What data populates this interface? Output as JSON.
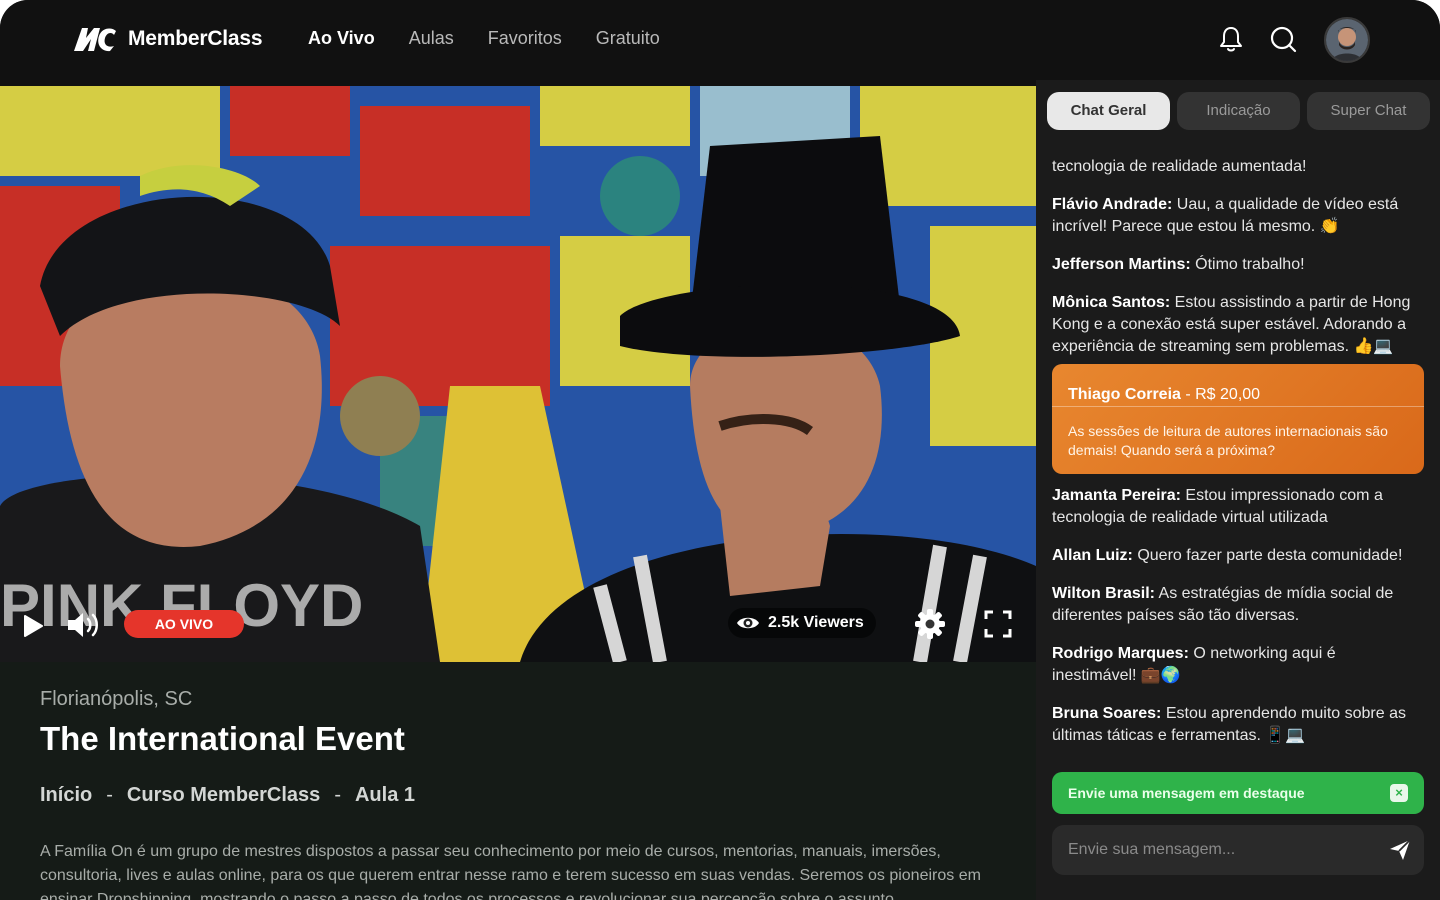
{
  "app": {
    "name": "MemberClass"
  },
  "nav": {
    "items": [
      "Ao Vivo",
      "Aulas",
      "Favoritos",
      "Gratuito"
    ],
    "active": "Ao Vivo"
  },
  "header": {
    "icons": [
      "bell-icon",
      "search-icon"
    ],
    "avatar": "user-avatar"
  },
  "video": {
    "live_label": "AO VIVO",
    "viewers": "2.5k Viewers",
    "controls": [
      "play-icon",
      "volume-icon",
      "eye-icon",
      "gear-icon",
      "fullscreen-icon"
    ]
  },
  "event": {
    "location": "Florianópolis, SC",
    "title": "The International Event",
    "breadcrumb": [
      "Início",
      "Curso MemberClass",
      "Aula 1"
    ],
    "breadcrumb_sep": "-",
    "description": "A Família On é um grupo de mestres dispostos a passar seu conhecimento por meio de cursos, mentorias, manuais, imersões, consultoria, lives e aulas online, para os que querem entrar nesse ramo e terem sucesso em suas vendas. Seremos os pioneiros em ensinar Dropshipping, mostrando o passo a passo de todos os processos e revolucionar sua percepção sobre o assunto."
  },
  "chat": {
    "tabs": [
      "Chat Geral",
      "Indicação",
      "Super Chat"
    ],
    "active_tab": "Chat Geral",
    "messages_top": [
      {
        "author": "",
        "text": "tecnologia de realidade aumentada!"
      },
      {
        "author": "Flávio Andrade:",
        "text": " Uau, a qualidade de vídeo está incrível! Parece que estou lá mesmo. 👏"
      },
      {
        "author": "Jefferson Martins:",
        "text": " Ótimo trabalho!"
      },
      {
        "author": "Mônica Santos:",
        "text": "  Estou assistindo a partir de Hong Kong e a conexão está super estável. Adorando a experiência de streaming sem problemas. 👍💻"
      }
    ],
    "superchat": {
      "author": "Thiago Correia",
      "amount": " - R$ 20,00",
      "text": "As sessões de leitura de autores internacionais são demais! Quando será a próxima?"
    },
    "messages_bottom": [
      {
        "author": "Jamanta Pereira:",
        "text": " Estou impressionado com a tecnologia de realidade virtual utilizada"
      },
      {
        "author": "Allan Luiz:",
        "text": " Quero fazer parte desta comunidade!"
      },
      {
        "author": "Wilton Brasil:",
        "text": " As estratégias de mídia social de diferentes países são tão diversas."
      },
      {
        "author": "Rodrigo Marques:",
        "text": " O networking aqui é inestimável! 💼🌍"
      },
      {
        "author": "Bruna Soares:",
        "text": " Estou aprendendo muito sobre as últimas táticas e ferramentas. 📱💻"
      }
    ],
    "highlight_label": "Envie uma mensagem em destaque",
    "highlight_close": "×",
    "input_placeholder": "Envie sua mensagem...",
    "colors": {
      "superchat": "#e07a25",
      "highlight": "#2fb34a",
      "live": "#e5352b"
    }
  }
}
